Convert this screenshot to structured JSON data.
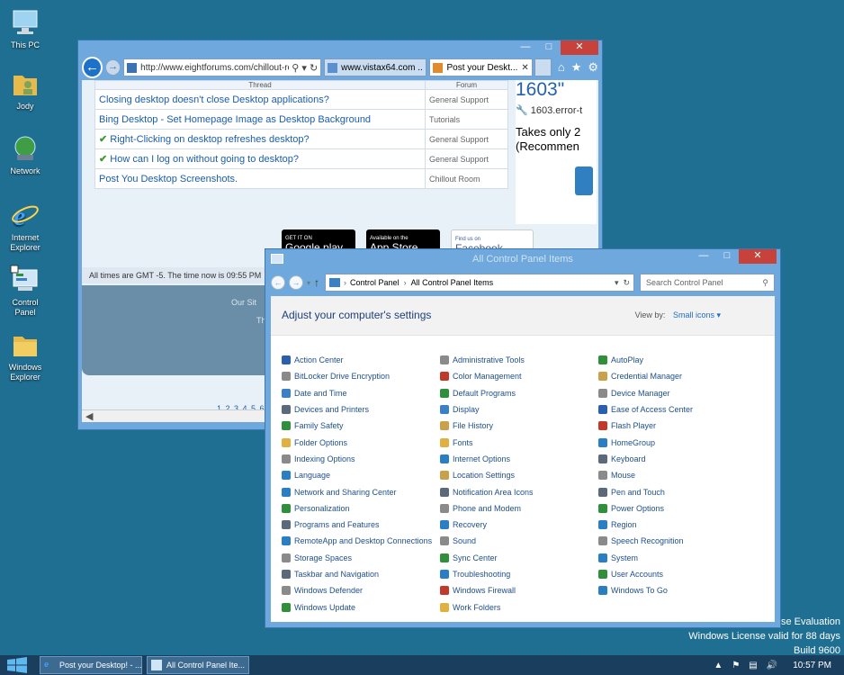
{
  "desktop": {
    "icons": [
      {
        "label": "This PC",
        "icon": "computer-icon"
      },
      {
        "label": "Jody",
        "icon": "user-folder-icon"
      },
      {
        "label": "Network",
        "icon": "network-icon"
      },
      {
        "label": "Internet Explorer",
        "icon": "ie-icon"
      },
      {
        "label": "Control Panel",
        "icon": "control-panel-icon"
      },
      {
        "label": "Windows Explorer",
        "icon": "folder-icon"
      }
    ],
    "watermark": {
      "line1": "rise Evaluation",
      "line2": "Windows License valid for 88 days",
      "line3": "Build 9600"
    },
    "background_color": "#1f6f93"
  },
  "ie": {
    "address": "http://www.eightforums.com/chillout-room",
    "address_domain": "eightforums.com",
    "tabs": [
      {
        "label": "www.vistax64.com ...",
        "active": false
      },
      {
        "label": "Post your Deskt...",
        "active": true
      }
    ],
    "table": {
      "headers": [
        "Thread",
        "Forum"
      ],
      "rows": [
        {
          "thread": "Closing desktop doesn't close Desktop applications?",
          "forum": "General Support",
          "checked": false
        },
        {
          "thread": "Bing Desktop - Set Homepage Image as Desktop Background",
          "forum": "Tutorials",
          "checked": false
        },
        {
          "thread": "Right-Clicking on desktop refreshes desktop?",
          "forum": "General Support",
          "checked": true
        },
        {
          "thread": "How can I log on without going to desktop?",
          "forum": "General Support",
          "checked": true
        },
        {
          "thread": "Post You Desktop Screenshots.",
          "forum": "Chillout Room",
          "checked": false
        }
      ]
    },
    "ad": {
      "headline": "1603\"",
      "link": "1603.error-t",
      "line1": "Takes only 2",
      "line2": "(Recommen"
    },
    "badges": {
      "google_small": "GET IT ON",
      "google": "Google play",
      "apple_small": "Available on the",
      "apple": "App Store",
      "facebook_small": "Find us on",
      "facebook": "Facebook"
    },
    "time_text": "All times are GMT -5. The time now is 09:55 PM",
    "footer_line1": "Our Sit",
    "footer_line2": "Th",
    "pager": "1 2 3 4 5 6"
  },
  "control_panel": {
    "title": "All Control Panel Items",
    "breadcrumb": [
      "Control Panel",
      "All Control Panel Items"
    ],
    "search_placeholder": "Search Control Panel",
    "heading": "Adjust your computer's settings",
    "view_by_label": "View by:",
    "view_by_value": "Small icons",
    "items": [
      {
        "label": "Action Center",
        "color": "#2a5fb0"
      },
      {
        "label": "Administrative Tools",
        "color": "#8a8a8a"
      },
      {
        "label": "AutoPlay",
        "color": "#2f8f3a"
      },
      {
        "label": "BitLocker Drive Encryption",
        "color": "#8a8a8a"
      },
      {
        "label": "Color Management",
        "color": "#c0392b"
      },
      {
        "label": "Credential Manager",
        "color": "#c8a14a"
      },
      {
        "label": "Date and Time",
        "color": "#3b7fc4"
      },
      {
        "label": "Default Programs",
        "color": "#2f8f3a"
      },
      {
        "label": "Device Manager",
        "color": "#8a8a8a"
      },
      {
        "label": "Devices and Printers",
        "color": "#5a6a7a"
      },
      {
        "label": "Display",
        "color": "#3b7fc4"
      },
      {
        "label": "Ease of Access Center",
        "color": "#2a5fb0"
      },
      {
        "label": "Family Safety",
        "color": "#2f8f3a"
      },
      {
        "label": "File History",
        "color": "#c8a14a"
      },
      {
        "label": "Flash Player",
        "color": "#c0392b"
      },
      {
        "label": "Folder Options",
        "color": "#e0b040"
      },
      {
        "label": "Fonts",
        "color": "#e0b040"
      },
      {
        "label": "HomeGroup",
        "color": "#2a7fc4"
      },
      {
        "label": "Indexing Options",
        "color": "#8a8a8a"
      },
      {
        "label": "Internet Options",
        "color": "#2a7fc4"
      },
      {
        "label": "Keyboard",
        "color": "#5a6a7a"
      },
      {
        "label": "Language",
        "color": "#2a7fc4"
      },
      {
        "label": "Location Settings",
        "color": "#c8a14a"
      },
      {
        "label": "Mouse",
        "color": "#8a8a8a"
      },
      {
        "label": "Network and Sharing Center",
        "color": "#2a7fc4"
      },
      {
        "label": "Notification Area Icons",
        "color": "#5a6a7a"
      },
      {
        "label": "Pen and Touch",
        "color": "#5a6a7a"
      },
      {
        "label": "Personalization",
        "color": "#2f8f3a"
      },
      {
        "label": "Phone and Modem",
        "color": "#8a8a8a"
      },
      {
        "label": "Power Options",
        "color": "#2f8f3a"
      },
      {
        "label": "Programs and Features",
        "color": "#5a6a7a"
      },
      {
        "label": "Recovery",
        "color": "#2a7fc4"
      },
      {
        "label": "Region",
        "color": "#2a7fc4"
      },
      {
        "label": "RemoteApp and Desktop Connections",
        "color": "#2a7fc4"
      },
      {
        "label": "Sound",
        "color": "#8a8a8a"
      },
      {
        "label": "Speech Recognition",
        "color": "#8a8a8a"
      },
      {
        "label": "Storage Spaces",
        "color": "#8a8a8a"
      },
      {
        "label": "Sync Center",
        "color": "#2f8f3a"
      },
      {
        "label": "System",
        "color": "#2a7fc4"
      },
      {
        "label": "Taskbar and Navigation",
        "color": "#5a6a7a"
      },
      {
        "label": "Troubleshooting",
        "color": "#2a7fc4"
      },
      {
        "label": "User Accounts",
        "color": "#2f8f3a"
      },
      {
        "label": "Windows Defender",
        "color": "#8a8a8a"
      },
      {
        "label": "Windows Firewall",
        "color": "#c0392b"
      },
      {
        "label": "Windows To Go",
        "color": "#2a7fc4"
      },
      {
        "label": "Windows Update",
        "color": "#2f8f3a"
      },
      {
        "label": "Work Folders",
        "color": "#e0b040"
      }
    ]
  },
  "taskbar": {
    "buttons": [
      {
        "label": "Post your Desktop! - ..."
      },
      {
        "label": "All Control Panel Ite..."
      }
    ],
    "clock": "10:57 PM"
  }
}
